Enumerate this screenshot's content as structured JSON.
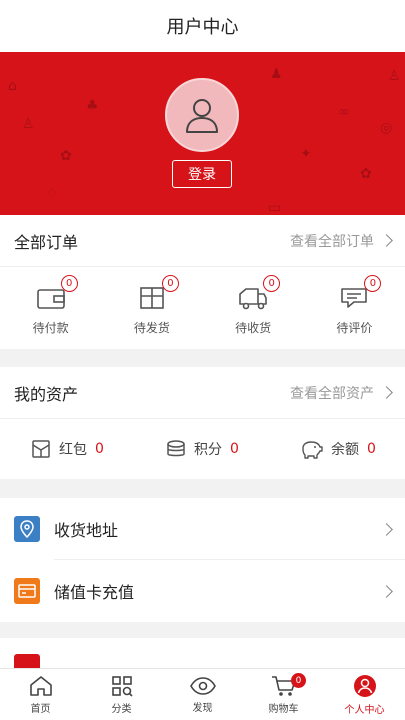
{
  "header": {
    "title": "用户中心"
  },
  "profile": {
    "login_label": "登录"
  },
  "orders": {
    "title": "全部订单",
    "view_all": "查看全部订单",
    "items": [
      {
        "label": "待付款",
        "count": "0",
        "icon": "wallet-icon"
      },
      {
        "label": "待发货",
        "count": "0",
        "icon": "package-icon"
      },
      {
        "label": "待收货",
        "count": "0",
        "icon": "truck-icon"
      },
      {
        "label": "待评价",
        "count": "0",
        "icon": "comment-icon"
      }
    ]
  },
  "assets": {
    "title": "我的资产",
    "view_all": "查看全部资产",
    "items": [
      {
        "label": "红包",
        "value": "0",
        "icon": "red-envelope-icon"
      },
      {
        "label": "积分",
        "value": "0",
        "icon": "coins-icon"
      },
      {
        "label": "余额",
        "value": "0",
        "icon": "piggy-bank-icon"
      }
    ]
  },
  "menu": [
    {
      "label": "收货地址",
      "icon": "location-icon",
      "color": "#3b7fc4"
    },
    {
      "label": "储值卡充值",
      "icon": "card-icon",
      "color": "#f07a1a"
    }
  ],
  "tabbar": [
    {
      "label": "首页",
      "icon": "home-icon"
    },
    {
      "label": "分类",
      "icon": "category-icon"
    },
    {
      "label": "发现",
      "icon": "eye-icon"
    },
    {
      "label": "购物车",
      "icon": "cart-icon",
      "badge": "0"
    },
    {
      "label": "个人中心",
      "icon": "user-icon",
      "active": true
    }
  ],
  "colors": {
    "accent": "#d7131a"
  }
}
